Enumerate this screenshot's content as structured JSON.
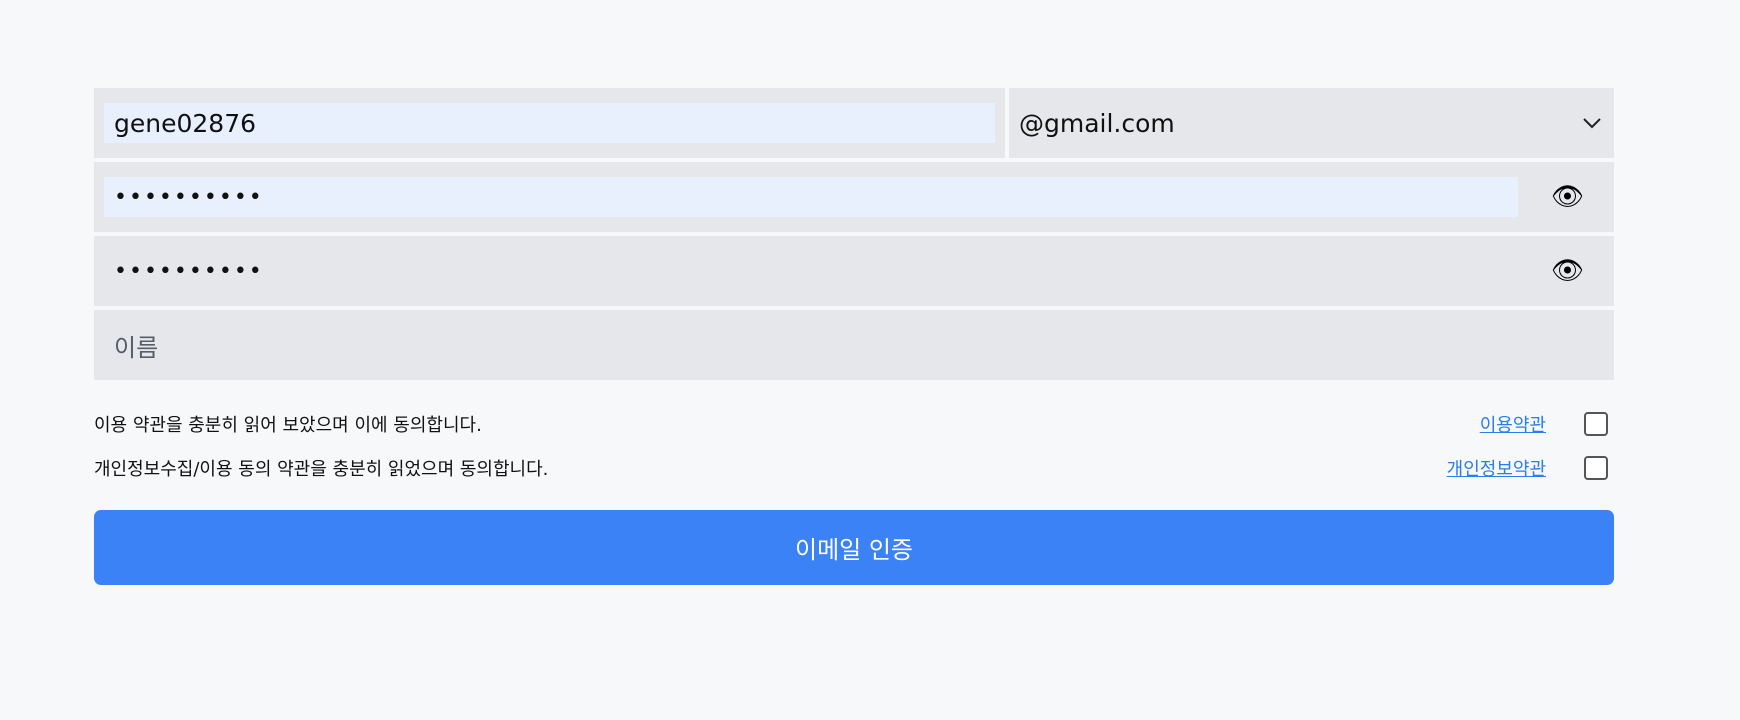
{
  "email": {
    "local_value": "gene02876",
    "domain_value": "@gmail.com"
  },
  "password": {
    "value_mask": "••••••••••",
    "eye_icon": "👁"
  },
  "password_confirm": {
    "value_mask": "••••••••••",
    "eye_icon": "👁"
  },
  "name": {
    "placeholder": "이름"
  },
  "agreements": [
    {
      "text": "이용 약관을 충분히 읽어 보았으며 이에 동의합니다.",
      "link": "이용약관",
      "checked": false
    },
    {
      "text": "개인정보수집/이용 동의 약관을 충분히 읽었으며 동의합니다.",
      "link": "개인정보약관",
      "checked": false
    }
  ],
  "submit_label": "이메일 인증",
  "colors": {
    "primary": "#3b82f6",
    "link": "#2b7de9",
    "field_bg": "#e5e7eb",
    "autofill_bg": "#e8f0fe"
  }
}
